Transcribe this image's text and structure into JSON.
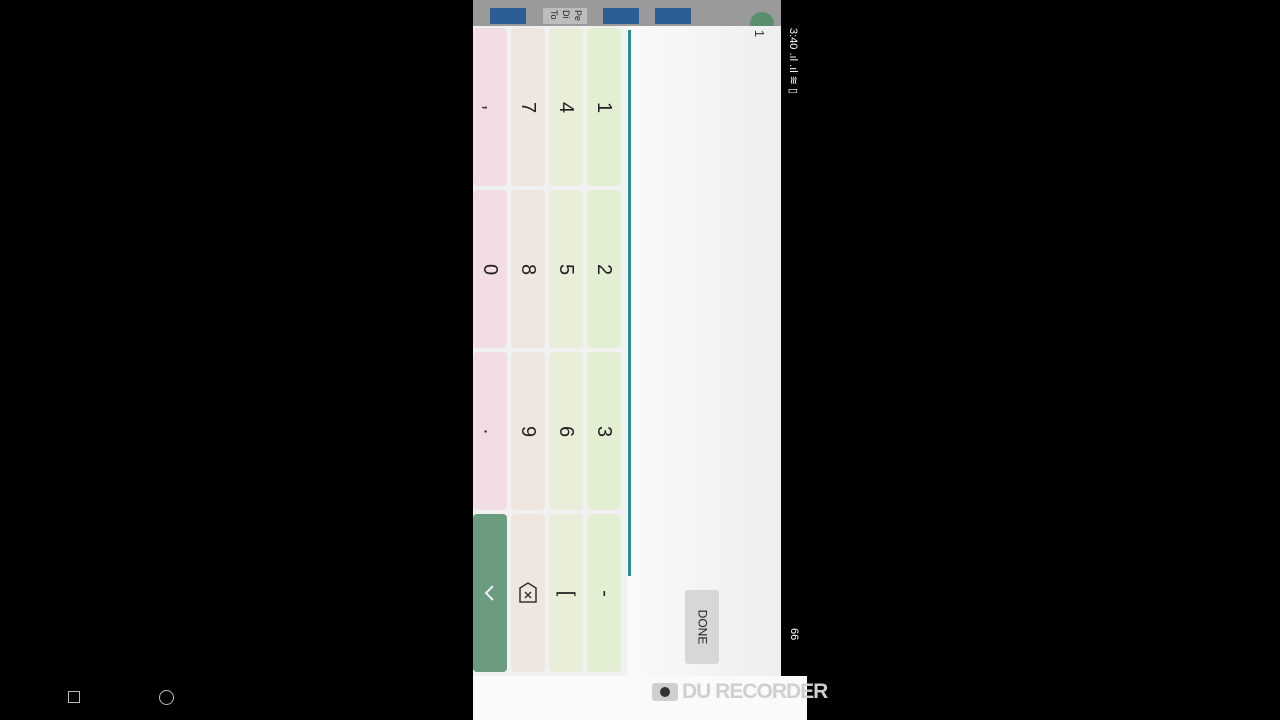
{
  "statusbar": {
    "time_signal": "3:40 .ıl .ıl ≋ ▯",
    "battery": "66"
  },
  "header": {
    "bg_snippets": [
      "Pe",
      "Di",
      "To"
    ],
    "field_value": "1"
  },
  "keypad": {
    "column_keys": [
      [
        "1",
        "2",
        "3",
        "-"
      ],
      [
        "4",
        "5",
        "6",
        "["
      ],
      [
        "7",
        "8",
        "9",
        "backspace"
      ],
      [
        ",",
        "0",
        ".",
        "back"
      ]
    ]
  },
  "done_label": "DONE",
  "watermark": "DU RECORDER",
  "colors": {
    "accent": "#2a8f8f",
    "key_green": "#e3efd3",
    "key_beige": "#efe7df",
    "key_pink": "#f2dde5",
    "back_key": "#6a9c7d"
  }
}
